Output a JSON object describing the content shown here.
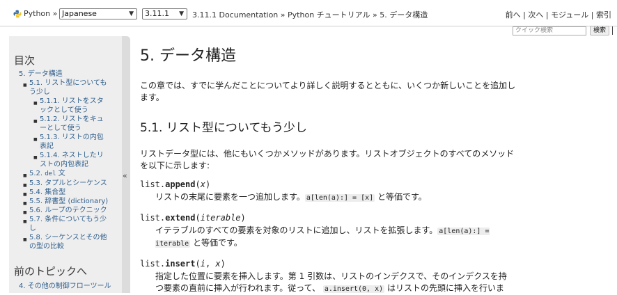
{
  "topbar": {
    "crumb_python": "Python »",
    "language": "Japanese",
    "version": "3.11.1",
    "breadcrumbs": [
      {
        "label": "3.11.1 Documentation",
        "sep": " » "
      },
      {
        "label": "Python チュートリアル",
        "sep": " » "
      },
      {
        "label": "5. データ構造",
        "sep": ""
      }
    ],
    "nav": [
      {
        "label": "前へ",
        "sep": " | "
      },
      {
        "label": "次へ",
        "sep": " | "
      },
      {
        "label": "モジュール",
        "sep": " | "
      },
      {
        "label": "索引",
        "sep": ""
      }
    ]
  },
  "search": {
    "placeholder": "クイック検索",
    "button": "検索"
  },
  "sidebar": {
    "toc_heading": "目次",
    "toc": [
      {
        "level": 0,
        "lines": [
          "5. データ構造"
        ]
      },
      {
        "level": 1,
        "lines": [
          "5.1. リスト型についても",
          "う少し"
        ]
      },
      {
        "level": 2,
        "lines": [
          "5.1.1. リストをスタ",
          "ックとして使う"
        ]
      },
      {
        "level": 2,
        "lines": [
          "5.1.2. リストをキュ",
          "ーとして使う"
        ]
      },
      {
        "level": 2,
        "lines": [
          "5.1.3. リストの内包",
          "表記"
        ]
      },
      {
        "level": 2,
        "lines": [
          "5.1.4. ネストしたリ",
          "ストの内包表記"
        ]
      },
      {
        "level": 1,
        "lines": [
          "5.2. ",
          "del",
          " 文"
        ],
        "code": true
      },
      {
        "level": 1,
        "lines": [
          "5.3. タプルとシーケンス"
        ]
      },
      {
        "level": 1,
        "lines": [
          "5.4. 集合型"
        ]
      },
      {
        "level": 1,
        "lines": [
          "5.5. 辞書型 (dictionary)"
        ]
      },
      {
        "level": 1,
        "lines": [
          "5.6. ループのテクニック"
        ]
      },
      {
        "level": 1,
        "lines": [
          "5.7. 条件についてもう少",
          "し"
        ]
      },
      {
        "level": 1,
        "lines": [
          "5.8. シーケンスとその他",
          "の型の比較"
        ]
      }
    ],
    "prev_heading": "前のトピックへ",
    "prev_link": "4. その他の制御フローツール",
    "collapse_glyph": "«"
  },
  "main": {
    "title": "5. データ構造",
    "intro": "この章では、すでに学んだことについてより詳しく説明するとともに、いくつか新しいことを追加します。",
    "section_title": "5.1. リスト型についてもう少し",
    "section_intro": "リストデータ型には、他にもいくつかメソッドがあります。リストオブジェクトのすべてのメソッドを以下に示します:",
    "methods": [
      {
        "prefix": "list.",
        "name": "append",
        "args": [
          {
            "text": "x",
            "italic": true
          }
        ],
        "desc": [
          {
            "t": "リストの末尾に要素を一つ追加します。"
          },
          {
            "c": "a[len(a):] = [x]"
          },
          {
            "t": " と等価です。"
          }
        ]
      },
      {
        "prefix": "list.",
        "name": "extend",
        "args": [
          {
            "text": "iterable",
            "italic": true
          }
        ],
        "desc": [
          {
            "t": "イテラブルのすべての要素を対象のリストに追加し、リストを拡張します。"
          },
          {
            "c": "a[len(a):] = iterable"
          },
          {
            "t": " と等価です。"
          }
        ]
      },
      {
        "prefix": "list.",
        "name": "insert",
        "args": [
          {
            "text": "i",
            "italic": true
          },
          {
            "text": "x",
            "italic": true
          }
        ],
        "desc": [
          {
            "t": "指定した位置に要素を挿入します。第 1 引数は、リストのインデクスで、そのインデクスを持つ要素の直前に挿入が行われます。従って、 "
          },
          {
            "c": "a.insert(0, x)"
          },
          {
            "t": " はリストの先頭に挿入を行いま"
          }
        ]
      }
    ]
  }
}
